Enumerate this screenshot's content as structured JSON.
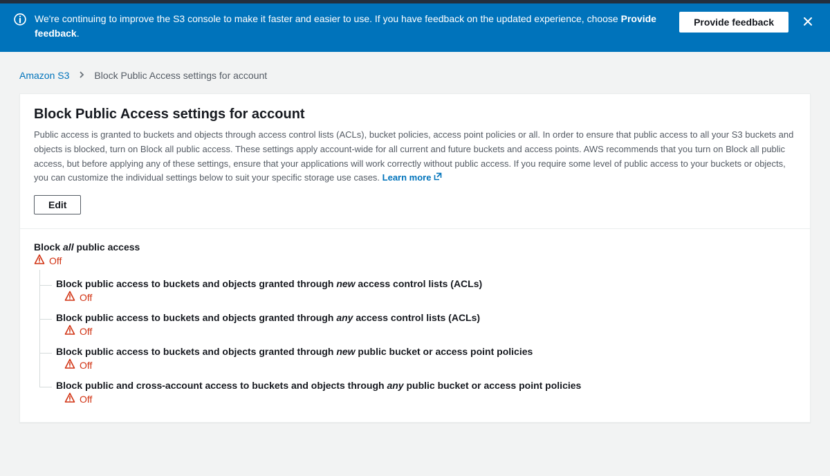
{
  "banner": {
    "text_before": "We're continuing to improve the S3 console to make it faster and easier to use. If you have feedback on the updated experience, choose ",
    "text_bold": "Provide feedback",
    "text_after": ".",
    "button": "Provide feedback"
  },
  "breadcrumb": {
    "root": "Amazon S3",
    "current": "Block Public Access settings for account"
  },
  "panel": {
    "title": "Block Public Access settings for account",
    "description": "Public access is granted to buckets and objects through access control lists (ACLs), bucket policies, access point policies or all. In order to ensure that public access to all your S3 buckets and objects is blocked, turn on Block all public access. These settings apply account-wide for all current and future buckets and access points. AWS recommends that you turn on Block all public access, but before applying any of these settings, ensure that your applications will work correctly without public access. If you require some level of public access to your buckets or objects, you can customize the individual settings below to suit your specific storage use cases. ",
    "learn_more": "Learn more",
    "edit": "Edit"
  },
  "block_all": {
    "title_pre": "Block ",
    "title_em": "all",
    "title_post": " public access",
    "status": "Off"
  },
  "children": [
    {
      "pre": "Block public access to buckets and objects granted through ",
      "em": "new",
      "post": " access control lists (ACLs)",
      "status": "Off"
    },
    {
      "pre": "Block public access to buckets and objects granted through ",
      "em": "any",
      "post": " access control lists (ACLs)",
      "status": "Off"
    },
    {
      "pre": "Block public access to buckets and objects granted through ",
      "em": "new",
      "post": " public bucket or access point policies",
      "status": "Off"
    },
    {
      "pre": "Block public and cross-account access to buckets and objects through ",
      "em": "any",
      "post": " public bucket or access point policies",
      "status": "Off"
    }
  ]
}
